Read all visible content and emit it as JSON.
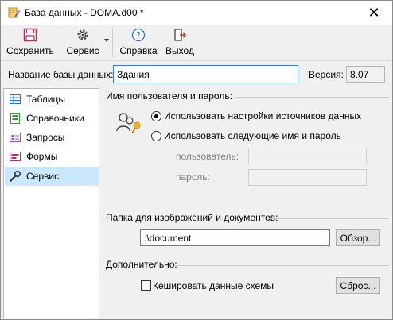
{
  "window": {
    "title": "База данных - DOMA.d00 *",
    "close_glyph": "✕"
  },
  "toolbar": {
    "buttons": [
      {
        "label": "Сохранить",
        "icon": "save-icon"
      },
      {
        "label": "Сервис",
        "icon": "gear-icon"
      },
      {
        "label": "Справка",
        "icon": "help-icon"
      },
      {
        "label": "Выход",
        "icon": "exit-icon"
      }
    ]
  },
  "database": {
    "name_label": "Название базы данных:",
    "name_value": "Здания",
    "version_label": "Версия:",
    "version_value": "8.07"
  },
  "sidebar": {
    "items": [
      {
        "label": "Таблицы",
        "icon": "table-icon"
      },
      {
        "label": "Справочники",
        "icon": "reference-icon"
      },
      {
        "label": "Запросы",
        "icon": "query-icon"
      },
      {
        "label": "Формы",
        "icon": "form-icon"
      },
      {
        "label": "Сервис",
        "icon": "wrench-icon",
        "selected": true
      }
    ]
  },
  "credentials": {
    "section_label": "Имя пользователя и пароль:",
    "option_source": "Использовать настройки источников данных",
    "option_custom": "Использовать следующие имя и пароль",
    "selected": "source",
    "user_label": "пользователь:",
    "password_label": "пароль:"
  },
  "folder": {
    "section_label": "Папка для изображений и документов:",
    "path_value": ".\\document",
    "browse_label": "Обзор..."
  },
  "extra": {
    "section_label": "Дополнительно:",
    "cache_label": "Кешировать данные схемы",
    "cache_checked": false,
    "reset_label": "Сброс..."
  },
  "colors": {
    "selection": "#cce8ff",
    "focus_border": "#3b78d8"
  }
}
